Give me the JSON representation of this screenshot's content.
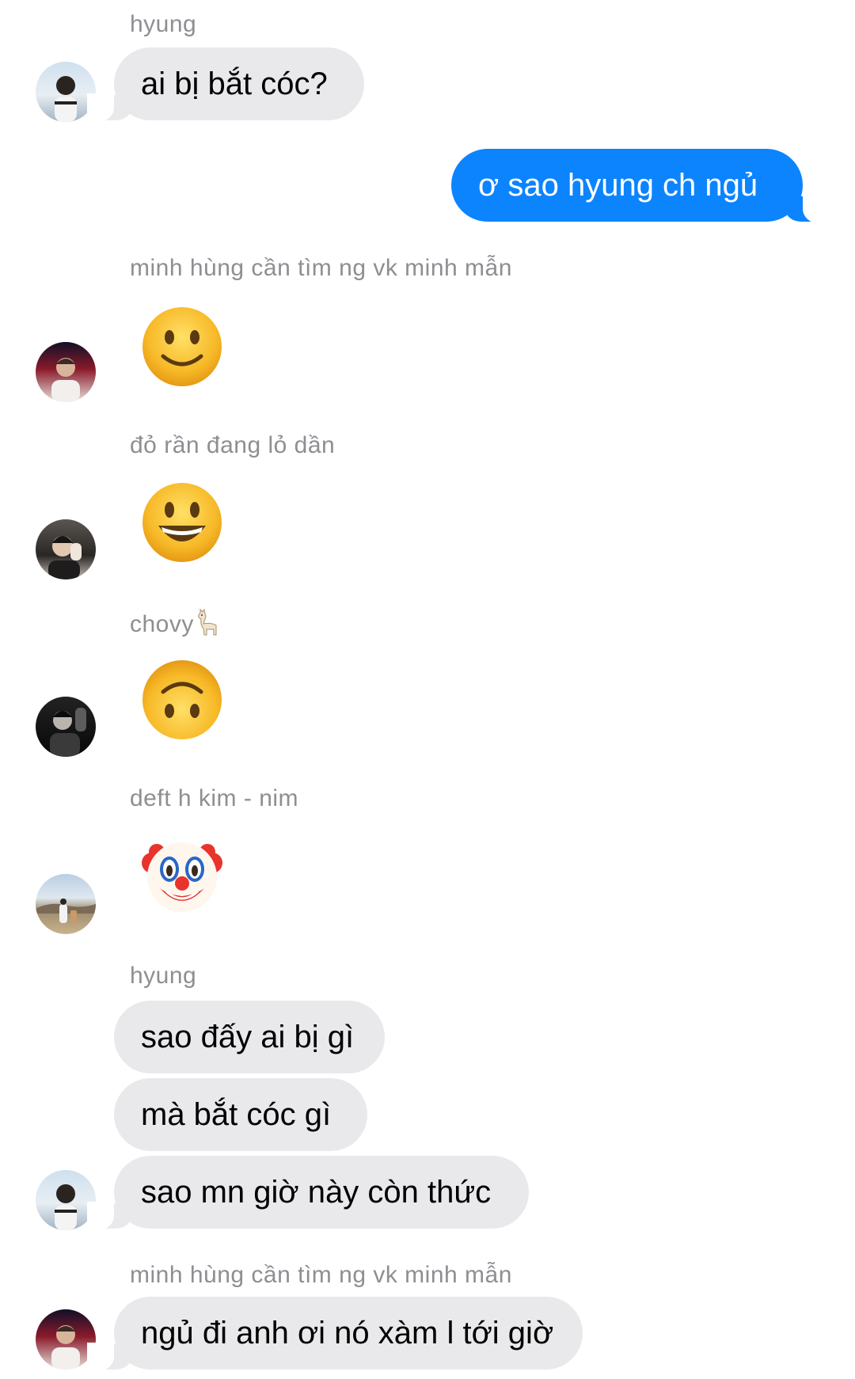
{
  "messages": [
    {
      "sender": "hyung",
      "text": "ai bị bắt cóc?"
    },
    {
      "text": "ơ sao hyung ch ngủ",
      "outgoing": true
    },
    {
      "sender": "minh hùng cần tìm ng vk minh mẫn",
      "emoji": "slightly-smiling-face"
    },
    {
      "sender": "đỏ rần đang lỏ dần",
      "emoji": "grinning-face"
    },
    {
      "sender": "chovy",
      "sender_icon": "llama-icon",
      "emoji": "upside-down-face"
    },
    {
      "sender": "deft h kim - nim",
      "emoji": "clown-face"
    },
    {
      "sender": "hyung",
      "texts": [
        "sao đấy ai bị gì",
        "mà bắt cóc gì",
        "sao mn giờ này còn thức"
      ]
    },
    {
      "sender": "minh hùng cần tìm ng vk minh mẫn",
      "text": "ngủ đi anh ơi nó xàm l tới giờ"
    }
  ],
  "colors": {
    "incoming_bubble": "#e9e9eb",
    "outgoing_bubble": "#0b84fe",
    "sender_label": "#8e8e93",
    "emoji_yellow": "#f7b928"
  }
}
